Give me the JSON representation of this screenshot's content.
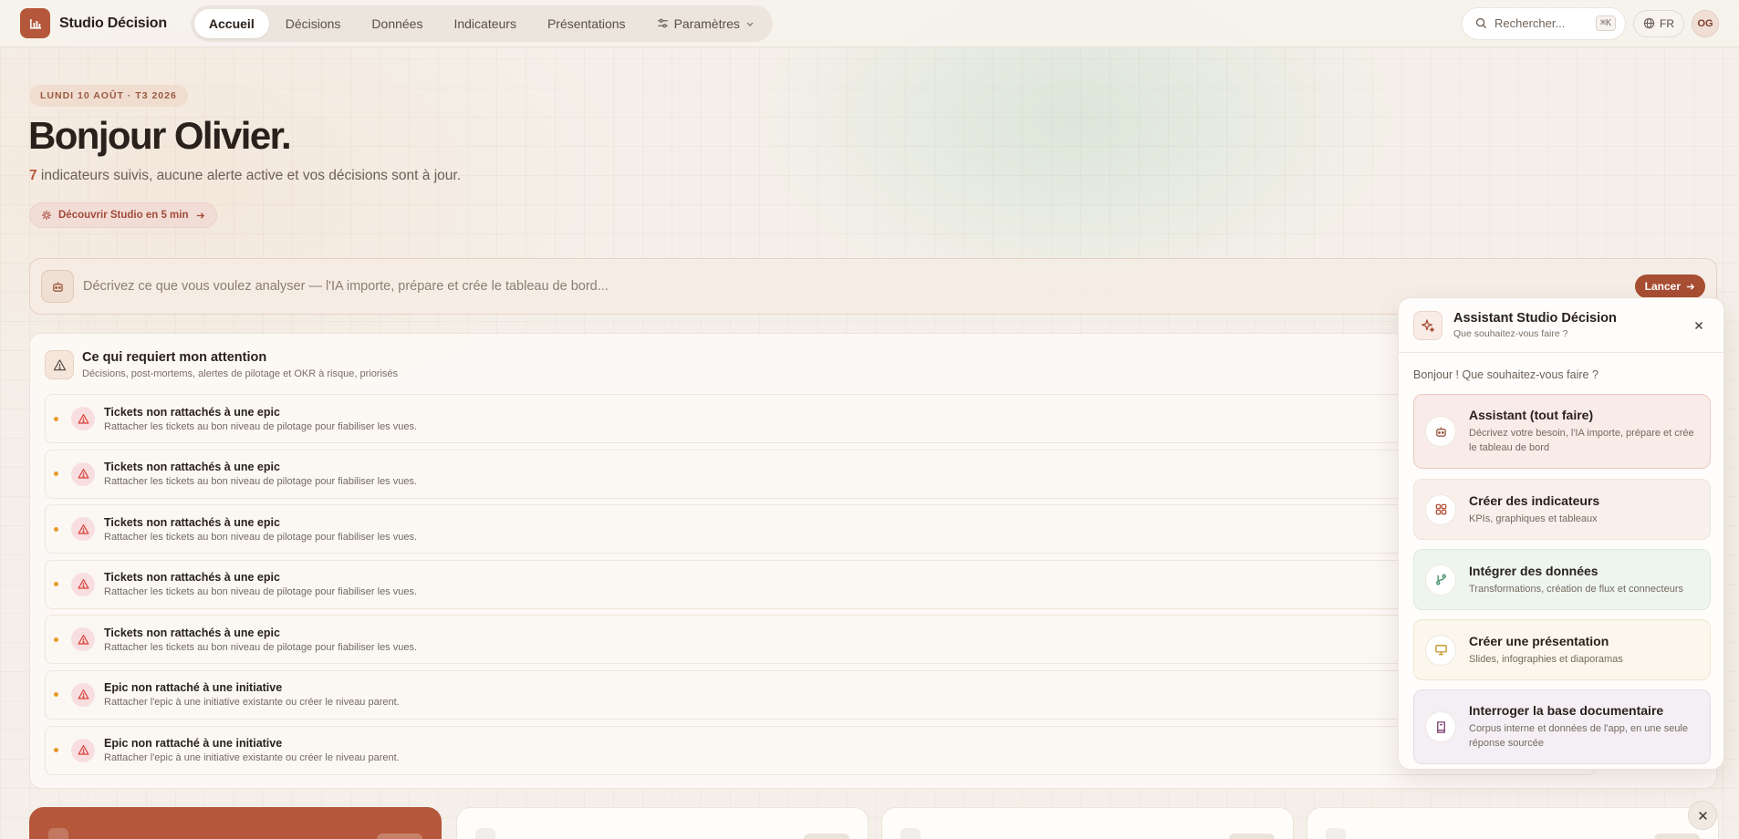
{
  "app": {
    "name": "Studio Décision"
  },
  "nav": {
    "items": [
      {
        "label": "Accueil",
        "active": true
      },
      {
        "label": "Décisions"
      },
      {
        "label": "Données"
      },
      {
        "label": "Indicateurs"
      },
      {
        "label": "Présentations"
      },
      {
        "label": "Paramètres"
      }
    ]
  },
  "header": {
    "search_placeholder": "Rechercher...",
    "search_shortcut": "⌘K",
    "lang": "FR",
    "avatar_initials": "OG"
  },
  "hero": {
    "date_chip": "LUNDI 10 AOÛT · T3 2026",
    "greeting": "Bonjour Olivier.",
    "indicators_count": "7",
    "summary": " indicateurs suivis, aucune alerte active et vos décisions sont à jour.",
    "discover_label": "Découvrir Studio en 5 min"
  },
  "prompt": {
    "placeholder": "Décrivez ce que vous voulez analyser — l'IA importe, prépare et crée le tableau de bord...",
    "launch_label": "Lancer"
  },
  "attention": {
    "title": "Ce qui requiert mon attention",
    "subtitle": "Décisions, post-mortems, alertes de pilotage et OKR à risque, priorisés",
    "items": [
      {
        "title": "Tickets non rattachés à une epic",
        "desc": "Rattacher les tickets au bon niveau de pilotage pour fiabiliser les vues."
      },
      {
        "title": "Tickets non rattachés à une epic",
        "desc": "Rattacher les tickets au bon niveau de pilotage pour fiabiliser les vues."
      },
      {
        "title": "Tickets non rattachés à une epic",
        "desc": "Rattacher les tickets au bon niveau de pilotage pour fiabiliser les vues."
      },
      {
        "title": "Tickets non rattachés à une epic",
        "desc": "Rattacher les tickets au bon niveau de pilotage pour fiabiliser les vues."
      },
      {
        "title": "Tickets non rattachés à une epic",
        "desc": "Rattacher les tickets au bon niveau de pilotage pour fiabiliser les vues."
      },
      {
        "title": "Epic non rattaché à une initiative",
        "desc": "Rattacher l'epic à une initiative existante ou créer le niveau parent."
      },
      {
        "title": "Epic non rattaché à une initiative",
        "desc": "Rattacher l'epic à une initiative existante ou créer le niveau parent."
      }
    ]
  },
  "assistant": {
    "title": "Assistant Studio Décision",
    "subtitle": "Que souhaitez-vous faire ?",
    "greeting": "Bonjour ! Que souhaitez-vous faire ?",
    "options": [
      {
        "title": "Assistant (tout faire)",
        "desc": "Décrivez votre besoin, l'IA importe, prépare et crée le tableau de bord",
        "icon": "bot-icon"
      },
      {
        "title": "Créer des indicateurs",
        "desc": "KPIs, graphiques et tableaux",
        "icon": "grid-icon"
      },
      {
        "title": "Intégrer des données",
        "desc": "Transformations, création de flux et connecteurs",
        "icon": "git-branch-icon"
      },
      {
        "title": "Créer une présentation",
        "desc": "Slides, infographies et diaporamas",
        "icon": "presentation-icon"
      },
      {
        "title": "Interroger la base documentaire",
        "desc": "Corpus interne et données de l'app, en une seule réponse sourcée",
        "icon": "book-icon"
      }
    ]
  },
  "colors": {
    "accent": "#b5573a",
    "warning": "#e89a2a",
    "alert": "#d9413b"
  }
}
